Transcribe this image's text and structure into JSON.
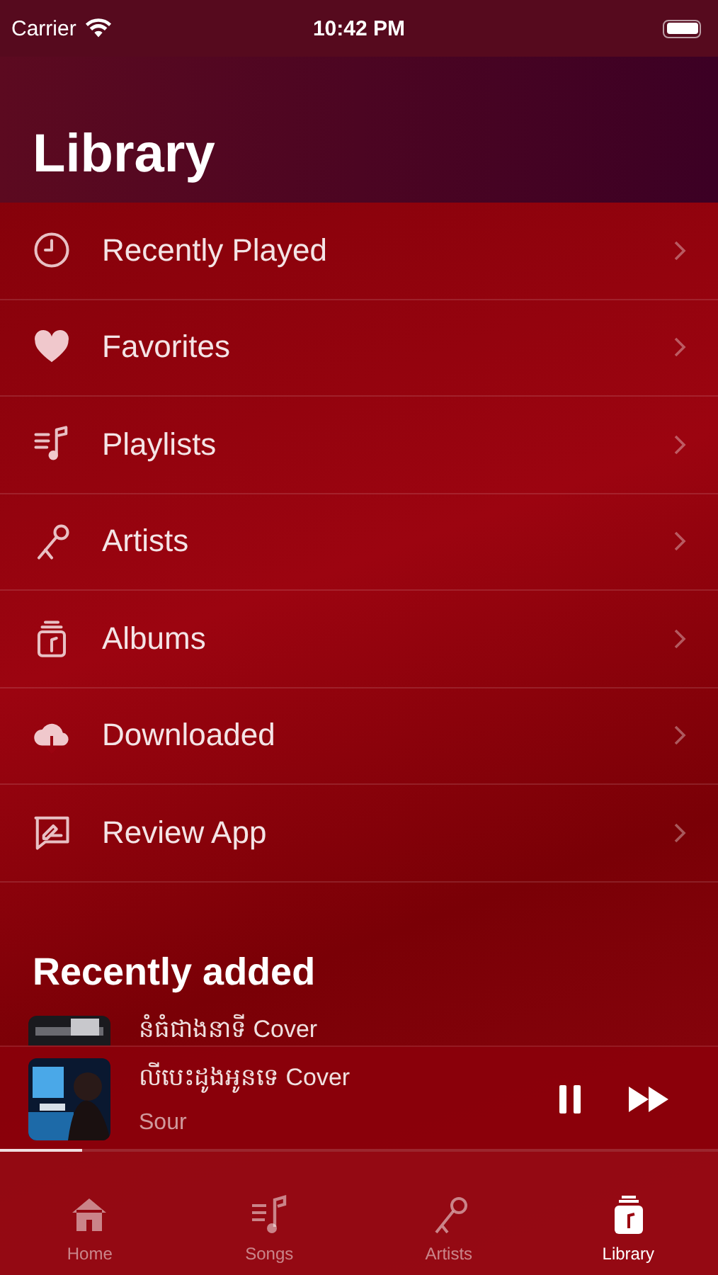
{
  "status_bar": {
    "carrier": "Carrier",
    "time": "10:42 PM"
  },
  "title": "Library",
  "menu": [
    {
      "label": "Recently Played"
    },
    {
      "label": "Favorites"
    },
    {
      "label": "Playlists"
    },
    {
      "label": "Artists"
    },
    {
      "label": "Albums"
    },
    {
      "label": "Downloaded"
    },
    {
      "label": "Review App"
    }
  ],
  "recently_added": {
    "title": "Recently added",
    "items": [
      {
        "title": "នំធំជាងនាទី Cover"
      }
    ]
  },
  "now_playing": {
    "title": "លីបេះដូងអូនទេ Cover",
    "artist": "Sour",
    "level": 0.115
  },
  "tabs": [
    {
      "label": "Home",
      "selected": false
    },
    {
      "label": "Songs",
      "selected": false
    },
    {
      "label": "Artists",
      "selected": false
    },
    {
      "label": "Library",
      "selected": true
    }
  ]
}
